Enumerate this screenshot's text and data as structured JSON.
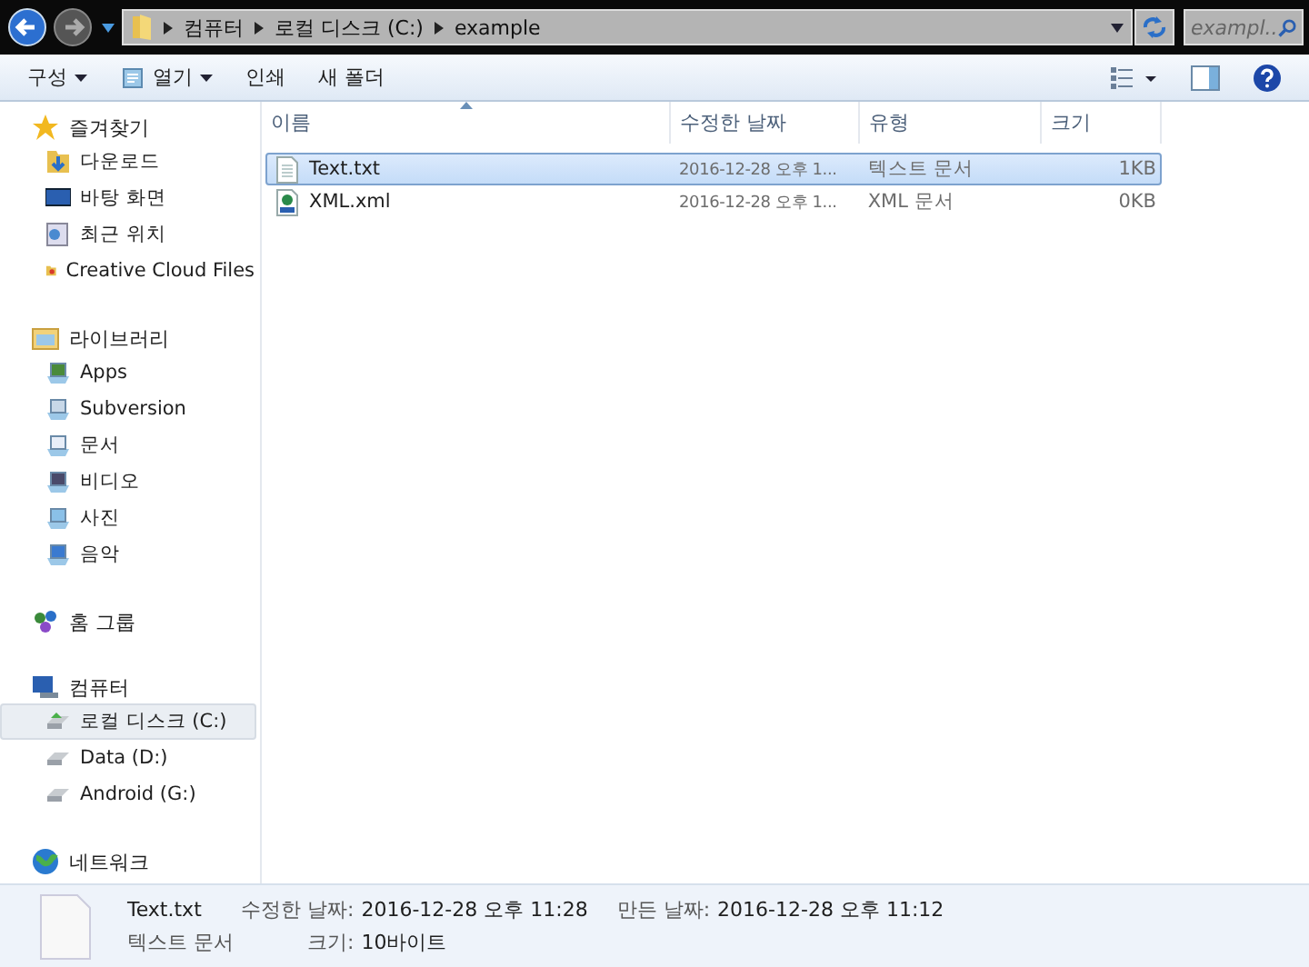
{
  "address": {
    "crumbs": [
      "컴퓨터",
      "로컬 디스크 (C:)",
      "example"
    ]
  },
  "search": {
    "placeholder": "exampl..."
  },
  "toolbar": {
    "buttons": [
      {
        "label": "구성",
        "dropdown": true,
        "icon": false
      },
      {
        "label": "열기",
        "dropdown": true,
        "icon": true
      },
      {
        "label": "인쇄",
        "dropdown": false,
        "icon": false
      },
      {
        "label": "새 폴더",
        "dropdown": false,
        "icon": false
      }
    ]
  },
  "sidebar": {
    "groups": [
      {
        "label": "즐겨찾기",
        "children": [
          {
            "label": "다운로드",
            "selected": false
          },
          {
            "label": "바탕 화면",
            "selected": false
          },
          {
            "label": "최근 위치",
            "selected": false
          },
          {
            "label": "Creative Cloud Files",
            "selected": false
          }
        ]
      },
      {
        "label": "라이브러리",
        "children": [
          {
            "label": "Apps",
            "selected": false
          },
          {
            "label": "Subversion",
            "selected": false
          },
          {
            "label": "문서",
            "selected": false
          },
          {
            "label": "비디오",
            "selected": false
          },
          {
            "label": "사진",
            "selected": false
          },
          {
            "label": "음악",
            "selected": false
          }
        ]
      },
      {
        "label": "홈 그룹"
      },
      {
        "label": "컴퓨터",
        "children": [
          {
            "label": "로컬 디스크 (C:)",
            "selected": true
          },
          {
            "label": "Data (D:)",
            "selected": false
          },
          {
            "label": "Android (G:)",
            "selected": false
          }
        ]
      },
      {
        "label": "네트워크"
      }
    ]
  },
  "table": {
    "columns": [
      {
        "label": "이름",
        "sorted": true
      },
      {
        "label": "수정한 날짜",
        "sorted": false
      },
      {
        "label": "유형",
        "sorted": false
      },
      {
        "label": "크기",
        "sorted": false
      }
    ],
    "rows": [
      {
        "name": "Text.txt",
        "modified": "2016-12-28 오후 1...",
        "type": "텍스트 문서",
        "size": "1KB",
        "kind": "text",
        "selected": true
      },
      {
        "name": "XML.xml",
        "modified": "2016-12-28 오후 1...",
        "type": "XML 문서",
        "size": "0KB",
        "kind": "xml",
        "selected": false
      }
    ]
  },
  "details": {
    "name": "Text.txt",
    "type": "텍스트 문서",
    "fields": [
      {
        "label": "수정한 날짜:",
        "value": "2016-12-28 오후 11:28"
      },
      {
        "label": "만든 날짜:",
        "value": "2016-12-28 오후 11:12"
      },
      {
        "label": "크기:",
        "value": "10바이트"
      }
    ]
  }
}
